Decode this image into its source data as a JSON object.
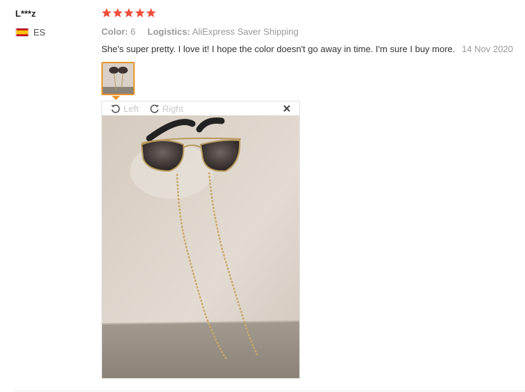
{
  "reviewer": {
    "name": "L***z",
    "country_code": "ES",
    "flag_icon": "spain-flag-icon"
  },
  "rating": {
    "stars": 5,
    "max": 5,
    "color": "#ef4e3a",
    "icon": "star-icon"
  },
  "meta": {
    "color_label": "Color:",
    "color_value": "6",
    "logistics_label": "Logistics:",
    "logistics_value": "AliExpress Saver Shipping"
  },
  "review": {
    "text": "She's super pretty. I love it! I hope the color doesn't go away in time. I'm sure I buy more.",
    "date": "14 Nov 2020"
  },
  "viewer": {
    "rotate_left_label": "Left",
    "rotate_right_label": "Right",
    "close_icon": "close-icon",
    "accent_color": "#e8962e"
  }
}
